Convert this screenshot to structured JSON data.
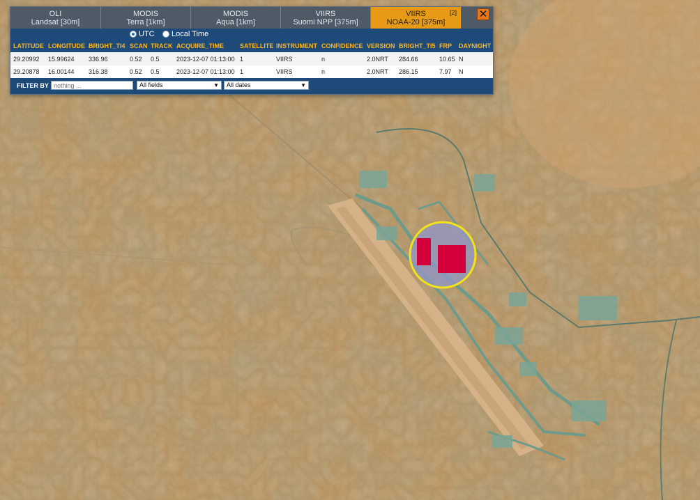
{
  "tabs": [
    {
      "line1": "OLI",
      "line2": "Landsat [30m]",
      "active": false
    },
    {
      "line1": "MODIS",
      "line2": "Terra [1km]",
      "active": false
    },
    {
      "line1": "MODIS",
      "line2": "Aqua [1km]",
      "active": false
    },
    {
      "line1": "VIIRS",
      "line2": "Suomi NPP [375m]",
      "active": false
    },
    {
      "line1": "VIIRS",
      "line2": "NOAA-20 [375m]",
      "active": true,
      "badge": "[2]"
    }
  ],
  "close_label": "✕",
  "time_mode": {
    "utc_label": "UTC",
    "local_label": "Local Time",
    "selected": "UTC"
  },
  "table": {
    "headers": [
      "LATITUDE",
      "LONGITUDE",
      "BRIGHT_TI4",
      "SCAN",
      "TRACK",
      "ACQUIRE_TIME",
      "SATELLITE",
      "INSTRUMENT",
      "CONFIDENCE",
      "VERSION",
      "BRIGHT_TI5",
      "FRP",
      "DAYNIGHT"
    ],
    "rows": [
      [
        "29.20992",
        "15.99624",
        "336.96",
        "0.52",
        "0.5",
        "2023-12-07 01:13:00",
        "1",
        "VIIRS",
        "n",
        "2.0NRT",
        "284.66",
        "10.65",
        "N"
      ],
      [
        "29.20878",
        "16.00144",
        "316.38",
        "0.52",
        "0.5",
        "2023-12-07 01:13:00",
        "1",
        "VIIRS",
        "n",
        "2.0NRT",
        "286.15",
        "7.97",
        "N"
      ]
    ]
  },
  "filter": {
    "label": "FILTER BY",
    "placeholder": "nothing ...",
    "field_select": "All fields",
    "date_select": "All dates"
  },
  "colors": {
    "active_tab": "#e69a16",
    "header_bar": "#1d4a78",
    "header_text": "#ffb41c",
    "fire_marker": "#d4003c",
    "highlight_ring": "#f2e21a"
  }
}
